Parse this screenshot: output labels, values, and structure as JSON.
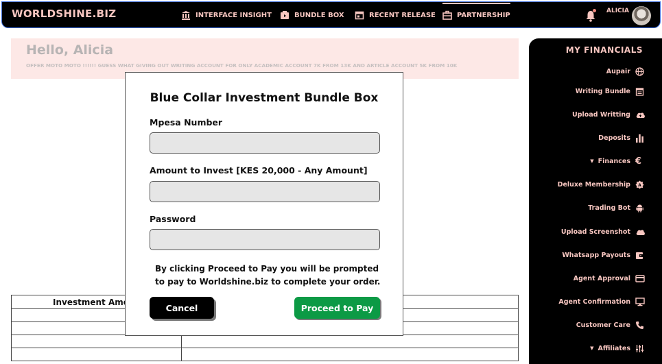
{
  "topbar": {
    "brand": "WORLDSHINE.BIZ",
    "nav": [
      {
        "label": "INTERFACE INSIGHT",
        "icon": "bank-icon"
      },
      {
        "label": "BUNDLE BOX",
        "icon": "video-box-icon"
      },
      {
        "label": "RECENT RELEASE",
        "icon": "calendar-icon"
      },
      {
        "label": "PARTNERSHIP",
        "icon": "briefcase-icon"
      }
    ],
    "username": "ALICIA"
  },
  "greeting": {
    "title": "Hello, Alicia",
    "ticker": "OFFER MOTO MOTO !!!!!! GUESS WHAT GIVING OUT WRITING ACCOUNT FOR ONLY ACADEMIC ACCOUNT 7K FROM 13K AND ARTICLE ACCOUNT 5K FROM 10K"
  },
  "table": {
    "header": "Investment Amo"
  },
  "sidebar": {
    "title": "MY FINANCIALS",
    "items": [
      {
        "label": "Aupair",
        "icon": "globe-icon"
      },
      {
        "label": "Writing Bundle",
        "icon": "calendar-icon"
      },
      {
        "label": "Upload Writting",
        "icon": "cloud-upload-icon"
      },
      {
        "label": "Deposits",
        "icon": "bar-chart-icon"
      },
      {
        "label": "Finances",
        "icon": "euro-icon"
      },
      {
        "label": "Deluxe Membership",
        "icon": "badge-icon"
      },
      {
        "label": "Trading Bot",
        "icon": "android-icon"
      },
      {
        "label": "Upload Screenshot",
        "icon": "cloud-icon"
      },
      {
        "label": "Whatsapp Payouts",
        "icon": "wallet-icon"
      },
      {
        "label": "Agent Approval",
        "icon": "credit-card-icon"
      },
      {
        "label": "Agent Confirmation",
        "icon": "monitor-icon"
      },
      {
        "label": "Customer Care",
        "icon": "phone-icon"
      },
      {
        "label": "Affiliates",
        "icon": "sliders-icon"
      }
    ]
  },
  "modal": {
    "title": "Blue Collar Investment Bundle Box",
    "mpesa_label": "Mpesa Number",
    "mpesa_value": "",
    "amount_label": "Amount to Invest [KES 20,000 - Any Amount]",
    "amount_value": "",
    "password_label": "Password",
    "password_value": "",
    "note": "By clicking Proceed to Pay you will be prompted to pay to Worldshine.biz to complete your order.",
    "cancel_label": "Cancel",
    "proceed_label": "Proceed to Pay"
  },
  "colors": {
    "accent_pink": "#f7c6c0",
    "proceed_green": "#0c9a45",
    "greeting_bg": "#fde8e6"
  }
}
